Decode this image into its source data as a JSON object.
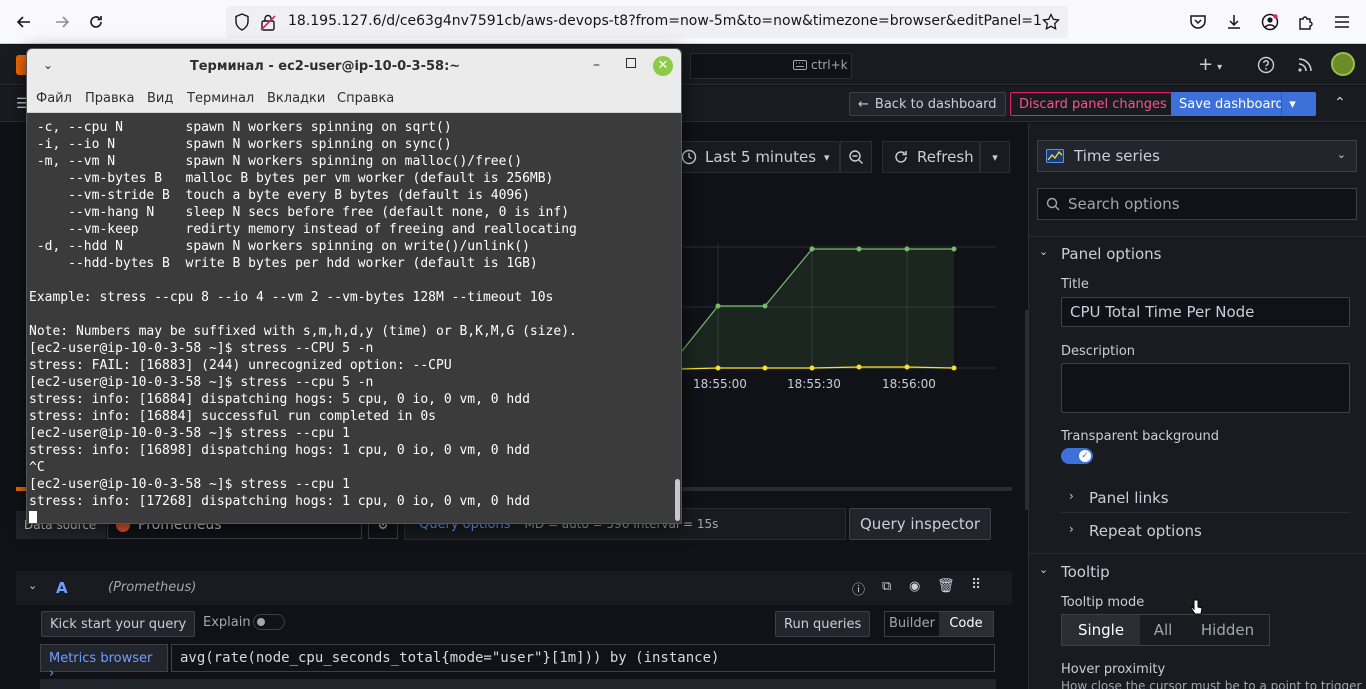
{
  "browser": {
    "url": "18.195.127.6/d/ce63g4nv7591cb/aws-devops-t8?from=now-5m&to=now&timezone=browser&editPanel=1"
  },
  "grafana": {
    "search_shortcut": "ctrl+k",
    "back_to_dashboard": "Back to dashboard",
    "discard_changes": "Discard panel changes",
    "save_dashboard": "Save dashboard",
    "time_range": "Last 5 minutes",
    "refresh": "Refresh",
    "chart_x_ticks": [
      "18:55:00",
      "18:55:30",
      "18:56:00"
    ],
    "datasource_label": "Data source",
    "datasource_value": "Prometheus",
    "query_options": "Query options",
    "query_options_meta": "MD = auto = 596   Interval = 15s",
    "query_inspector": "Query inspector",
    "query_ref": "A",
    "query_ds": "(Prometheus)",
    "kick_start": "Kick start your query",
    "explain": "Explain",
    "run_queries": "Run queries",
    "builder": "Builder",
    "code": "Code",
    "metrics_browser": "Metrics browser",
    "query_text": "avg(rate(node_cpu_seconds_total{mode=\"user\"}[1m])) by (instance)",
    "visualization": "Time series",
    "search_options": "Search options",
    "panel_options": "Panel options",
    "title_label": "Title",
    "title_value": "CPU Total Time Per Node",
    "description_label": "Description",
    "transparent_label": "Transparent background",
    "panel_links": "Panel links",
    "repeat_options": "Repeat options",
    "tooltip": "Tooltip",
    "tooltip_mode": "Tooltip mode",
    "tooltip_modes": [
      "Single",
      "All",
      "Hidden"
    ],
    "hover_proximity": "Hover proximity",
    "hover_desc": "How close the cursor must be to a point to trigger"
  },
  "terminal": {
    "title": "Терминал - ec2-user@ip-10-0-3-58:~",
    "menu": [
      "Файл",
      "Правка",
      "Вид",
      "Терминал",
      "Вкладки",
      "Справка"
    ],
    "lines": [
      " -c, --cpu N        spawn N workers spinning on sqrt()",
      " -i, --io N         spawn N workers spinning on sync()",
      " -m, --vm N         spawn N workers spinning on malloc()/free()",
      "     --vm-bytes B   malloc B bytes per vm worker (default is 256MB)",
      "     --vm-stride B  touch a byte every B bytes (default is 4096)",
      "     --vm-hang N    sleep N secs before free (default none, 0 is inf)",
      "     --vm-keep      redirty memory instead of freeing and reallocating",
      " -d, --hdd N        spawn N workers spinning on write()/unlink()",
      "     --hdd-bytes B  write B bytes per hdd worker (default is 1GB)",
      "",
      "Example: stress --cpu 8 --io 4 --vm 2 --vm-bytes 128M --timeout 10s",
      "",
      "Note: Numbers may be suffixed with s,m,h,d,y (time) or B,K,M,G (size).",
      "[ec2-user@ip-10-0-3-58 ~]$ stress --CPU 5 -n",
      "stress: FAIL: [16883] (244) unrecognized option: --CPU",
      "[ec2-user@ip-10-0-3-58 ~]$ stress --cpu 5 -n",
      "stress: info: [16884] dispatching hogs: 5 cpu, 0 io, 0 vm, 0 hdd",
      "stress: info: [16884] successful run completed in 0s",
      "[ec2-user@ip-10-0-3-58 ~]$ stress --cpu 1",
      "stress: info: [16898] dispatching hogs: 1 cpu, 0 io, 0 vm, 0 hdd",
      "^C",
      "[ec2-user@ip-10-0-3-58 ~]$ stress --cpu 1",
      "stress: info: [17268] dispatching hogs: 1 cpu, 0 io, 0 vm, 0 hdd"
    ]
  }
}
